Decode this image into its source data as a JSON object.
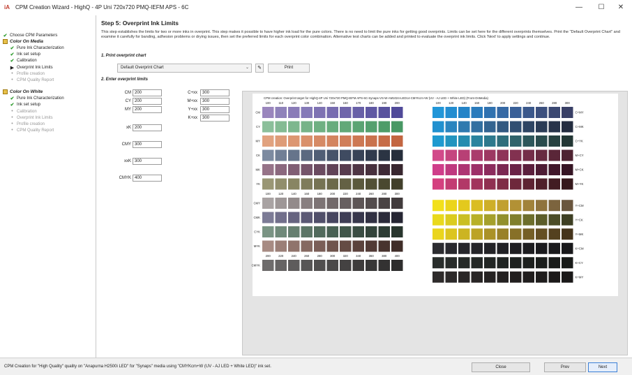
{
  "window": {
    "title": "CPM Creation Wizard - HighQ - 4P Uni 720x720 PMQ-IEFM APS - 6C",
    "logo": "iA",
    "minimize": "—",
    "maximize": "☐",
    "close": "✕"
  },
  "sidebar": {
    "items": [
      {
        "label": "Choose CPM Parameters",
        "icon": "check-icon",
        "state": "done",
        "kind": "item",
        "indent": 0
      },
      {
        "label": "Color On Media",
        "icon": "stage-icon",
        "state": "head",
        "kind": "head",
        "indent": 0
      },
      {
        "label": "Pure Ink Characterization",
        "icon": "check-icon",
        "state": "done",
        "kind": "item",
        "indent": 1
      },
      {
        "label": "Ink set setup",
        "icon": "check-icon",
        "state": "done",
        "kind": "item",
        "indent": 1
      },
      {
        "label": "Calibration",
        "icon": "check-icon",
        "state": "done",
        "kind": "item",
        "indent": 1
      },
      {
        "label": "Overprint Ink Limits",
        "icon": "arrow-icon",
        "state": "current",
        "kind": "item",
        "indent": 1
      },
      {
        "label": "Profile creation",
        "icon": "dot-icon",
        "state": "pending",
        "kind": "item",
        "indent": 1
      },
      {
        "label": "CPM Quality Report",
        "icon": "dot-icon",
        "state": "pending",
        "kind": "item",
        "indent": 1
      },
      {
        "label": "Color On White",
        "icon": "stage-icon",
        "state": "head",
        "kind": "head",
        "indent": 0
      },
      {
        "label": "Pure Ink Characterization",
        "icon": "check-icon",
        "state": "done",
        "kind": "item",
        "indent": 1
      },
      {
        "label": "Ink set setup",
        "icon": "check-icon",
        "state": "done",
        "kind": "item",
        "indent": 1
      },
      {
        "label": "Calibration",
        "icon": "dot-icon",
        "state": "pending",
        "kind": "item",
        "indent": 1
      },
      {
        "label": "Overprint Ink Limits",
        "icon": "dot-icon",
        "state": "pending",
        "kind": "item",
        "indent": 1
      },
      {
        "label": "Profile creation",
        "icon": "dot-icon",
        "state": "pending",
        "kind": "item",
        "indent": 1
      },
      {
        "label": "CPM Quality Report",
        "icon": "dot-icon",
        "state": "pending",
        "kind": "item",
        "indent": 1
      }
    ]
  },
  "main": {
    "title": "Step 5: Overprint Ink Limits",
    "description": "This step establishes the limits for two or more inks in overprint.  This step makes it possible to have higher ink load for the pure colors. There is no need to limit the pure inks for getting good overprints. Limits can be set here for the different overprints themselves. Print the \"Default Overprint Chart\" and examine it carefully for banding, adhesion problems or drying issues, then set the preferred limits for each overprint color combination. Alternative test charts can be added and printed to evaluate the overprint ink limits.  Click 'Next' to apply settings and continue.",
    "section1": "1. Print overprint chart",
    "chart_select_value": "Default Overprint Chart",
    "print_label": "Print",
    "section2": "2. Enter overprint limits",
    "limits_left": [
      {
        "label": "CM",
        "value": "200"
      },
      {
        "label": "CY",
        "value": "200"
      },
      {
        "label": "MY",
        "value": "200"
      },
      {
        "label": "xK",
        "value": "200"
      },
      {
        "label": "CMY",
        "value": "300"
      },
      {
        "label": "xxK",
        "value": "300"
      },
      {
        "label": "CMYK",
        "value": "400"
      }
    ],
    "limits_right": [
      {
        "label": "C+xx",
        "value": "300"
      },
      {
        "label": "M+xx",
        "value": "300"
      },
      {
        "label": "Y+xx",
        "value": "300"
      },
      {
        "label": "K+xx",
        "value": "300"
      }
    ]
  },
  "preview": {
    "title": "CPM creation: Overprint target for HighQ-4P Uni 720x720 PMQ-IEFM APS-6C-Synaps-VS-W-AM1024-LED14-CMYKcm+W (UV - AJ LED + White LED) (Front-OnMedia)",
    "left_cols_top": [
      "100",
      "110",
      "120",
      "130",
      "140",
      "150",
      "160",
      "170",
      "180",
      "190",
      "200"
    ],
    "right_cols_top": [
      "100",
      "120",
      "140",
      "160",
      "180",
      "200",
      "220",
      "240",
      "260",
      "280",
      "300"
    ],
    "left_rows_top": [
      "CM",
      "CY",
      "MY",
      "CK",
      "MK",
      "YK"
    ],
    "right_rows_top": [
      "C+MY",
      "C+MK",
      "C+YK",
      "M+CY",
      "M+CK",
      "M+YK"
    ],
    "left_cols_mid": [
      "100",
      "120",
      "140",
      "160",
      "180",
      "200",
      "220",
      "240",
      "260",
      "280",
      "300"
    ],
    "left_rows_mid": [
      "CMY",
      "CMK",
      "CYK",
      "MYK"
    ],
    "right_rows_mid": [
      "Y+CM",
      "Y+CK",
      "Y+MK",
      "K+CM",
      "K+CY",
      "K+MY"
    ],
    "cols_bottom": [
      "200",
      "220",
      "240",
      "260",
      "280",
      "300",
      "320",
      "340",
      "360",
      "380",
      "400"
    ],
    "row_bottom": "CMYK",
    "colors": {
      "CM": [
        "#9a86bd",
        "#8f82ba",
        "#8a7cb8",
        "#857ab8",
        "#7e72b3",
        "#776cb0",
        "#7066ab",
        "#6860a7",
        "#5f58a3",
        "#58529e",
        "#504a99"
      ],
      "CY": [
        "#8bbf9a",
        "#84bb93",
        "#7db78e",
        "#76b388",
        "#6fb082",
        "#68ac7d",
        "#62a878",
        "#5ba473",
        "#54a06e",
        "#4e9c69",
        "#489864"
      ],
      "MY": [
        "#e1a27f",
        "#de9c78",
        "#dc9672",
        "#d9906b",
        "#d68a65",
        "#d3845f",
        "#d07e59",
        "#cd7853",
        "#c9724d",
        "#c66c47",
        "#c36641"
      ],
      "CK": [
        "#7c8aa0",
        "#717f96",
        "#66748b",
        "#5b6980",
        "#505e75",
        "#47546b",
        "#3f4b61",
        "#384357",
        "#313b4d",
        "#2b3443",
        "#262e3b"
      ],
      "MK": [
        "#967388",
        "#8b687e",
        "#805e74",
        "#75546a",
        "#6b4b60",
        "#614357",
        "#583c4e",
        "#4f3645",
        "#47303d",
        "#3f2b36",
        "#38272f"
      ],
      "YK": [
        "#9a9775",
        "#918e6c",
        "#888563",
        "#7f7c5b",
        "#767353",
        "#6d6a4b",
        "#646144",
        "#5b593d",
        "#525036",
        "#4a4830",
        "#42402b"
      ],
      "CMY": [
        "#a9a3a3",
        "#9e9797",
        "#938b8b",
        "#887f80",
        "#7d7475",
        "#72696a",
        "#675f60",
        "#5d5556",
        "#534c4d",
        "#4a4344",
        "#413b3c"
      ],
      "CMK": [
        "#7c7b96",
        "#716f8b",
        "#666480",
        "#5b5975",
        "#504f6a",
        "#474660",
        "#3f3e56",
        "#37374c",
        "#313143",
        "#2b2b3a",
        "#262633"
      ],
      "CYK": [
        "#7a9484",
        "#708a7a",
        "#667f70",
        "#5c7566",
        "#526b5d",
        "#496154",
        "#41574b",
        "#3a4d43",
        "#33443b",
        "#2d3c34",
        "#28352d"
      ],
      "MYK": [
        "#a78b83",
        "#9b7f77",
        "#90746c",
        "#856961",
        "#7a5e57",
        "#6f544d",
        "#654b44",
        "#5b423c",
        "#513a35",
        "#48332e",
        "#3f2d28"
      ],
      "CMYK": [
        "#6e6c6c",
        "#666464",
        "#5e5c5c",
        "#575555",
        "#504e4e",
        "#4a4848",
        "#444242",
        "#3e3c3c",
        "#383737",
        "#333232",
        "#2e2d2d"
      ],
      "C+MY": [
        "#2196d8",
        "#228dd0",
        "#2484c7",
        "#2a7bbc",
        "#3072b0",
        "#3569a4",
        "#396098",
        "#3b588b",
        "#3c507e",
        "#3b4872",
        "#383f66"
      ],
      "C+MK": [
        "#2090cf",
        "#2a85bf",
        "#2f7aaf",
        "#326fa0",
        "#336490",
        "#325981",
        "#314f72",
        "#2e4563",
        "#2b3c56",
        "#28344a",
        "#242d40"
      ],
      "C+YK": [
        "#1f9ad0",
        "#2294bf",
        "#268caf",
        "#2a839e",
        "#2d798d",
        "#2f6e7c",
        "#2f636b",
        "#2d575b",
        "#2a4c4d",
        "#274140",
        "#233735"
      ],
      "M+CY": [
        "#d24a8a",
        "#c5457f",
        "#b84075",
        "#aa3b6c",
        "#9d3862",
        "#8f3459",
        "#823150",
        "#742d48",
        "#672a40",
        "#5a2638",
        "#4e2331"
      ],
      "M+CK": [
        "#cf3e8a",
        "#bf397f",
        "#ae3573",
        "#9d3068",
        "#8c2c5d",
        "#7b2852",
        "#6b2447",
        "#5c203d",
        "#4e1c34",
        "#41182b",
        "#361524"
      ],
      "M+YK": [
        "#d4407f",
        "#c33c73",
        "#b23867",
        "#a1345c",
        "#903051",
        "#7f2c46",
        "#6e283c",
        "#5e2433",
        "#4f202a",
        "#421c23",
        "#36181c"
      ],
      "Y+CM": [
        "#f2e01b",
        "#ebd51a",
        "#e3c91d",
        "#dabd22",
        "#ceaf29",
        "#c1a02f",
        "#b29135",
        "#a1823a",
        "#8f733d",
        "#7c643e",
        "#6a563e"
      ],
      "Y+CK": [
        "#e9d91d",
        "#dbcc1f",
        "#cabf24",
        "#b8b028",
        "#a5a02b",
        "#92902d",
        "#807f2d",
        "#6d6e2c",
        "#5c5d2a",
        "#4c4d27",
        "#3e3f23"
      ],
      "Y+MK": [
        "#ead51d",
        "#dcc51f",
        "#ccb422",
        "#bca325",
        "#ab9227",
        "#998128",
        "#877028",
        "#755f26",
        "#644f23",
        "#54411f",
        "#45341b"
      ],
      "K+CM": [
        "#2c2c30",
        "#29292e",
        "#27272c",
        "#252529",
        "#232327",
        "#212125",
        "#1f1f22",
        "#1d1d20",
        "#1b1b1e",
        "#1a1a1c",
        "#18181a"
      ],
      "K+CY": [
        "#2a2e2c",
        "#282c2a",
        "#262a28",
        "#242826",
        "#222624",
        "#202422",
        "#1e2220",
        "#1d201e",
        "#1b1e1c",
        "#1a1c1a",
        "#181a18"
      ],
      "K+MY": [
        "#2e2b2b",
        "#2c2929",
        "#2a2727",
        "#282525",
        "#262323",
        "#242121",
        "#221f1f",
        "#201d1d",
        "#1e1c1c",
        "#1c1a1a",
        "#1a1818"
      ]
    }
  },
  "statusbar": {
    "text": "CPM Creation for \"High Quality\" quality on \"Anapurna H2500i LED\" for \"Synaps\" media using \"CMYKcm+W (UV - AJ LED + White LED)\" ink set.",
    "close_label": "Close",
    "prev_label": "Prev",
    "next_label": "Next"
  }
}
